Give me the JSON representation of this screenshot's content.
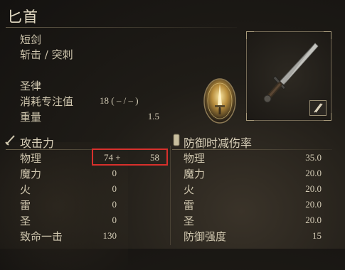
{
  "item": {
    "name": "匕首",
    "weapon_type": "短剑",
    "damage_type": "斩击 / 突刺",
    "skill_name": "圣律",
    "fp_label": "消耗专注值",
    "fp_value": "18 (  – /  – )",
    "weight_label": "重量",
    "weight_value": "1.5"
  },
  "attack": {
    "header": "攻击力",
    "rows": [
      {
        "label": "物理",
        "base": "74 +",
        "bonus": "58"
      },
      {
        "label": "魔力",
        "base": "0",
        "bonus": ""
      },
      {
        "label": "火",
        "base": "0",
        "bonus": ""
      },
      {
        "label": "雷",
        "base": "0",
        "bonus": ""
      },
      {
        "label": "圣",
        "base": "0",
        "bonus": ""
      },
      {
        "label": "致命一击",
        "base": "130",
        "bonus": ""
      }
    ]
  },
  "guard": {
    "header": "防御时减伤率",
    "rows": [
      {
        "label": "物理",
        "value": "35.0"
      },
      {
        "label": "魔力",
        "value": "20.0"
      },
      {
        "label": "火",
        "value": "20.0"
      },
      {
        "label": "雷",
        "value": "20.0"
      },
      {
        "label": "圣",
        "value": "20.0"
      },
      {
        "label": "防御强度",
        "value": "15"
      }
    ]
  },
  "colors": {
    "highlight": "#d8302c",
    "accent_gold": "#c9a54a"
  },
  "icons": {
    "skill": "holy-sword-icon",
    "weapon": "dagger-icon",
    "attack": "sword-icon",
    "guard": "shield-icon",
    "affinity": "pen-icon"
  }
}
